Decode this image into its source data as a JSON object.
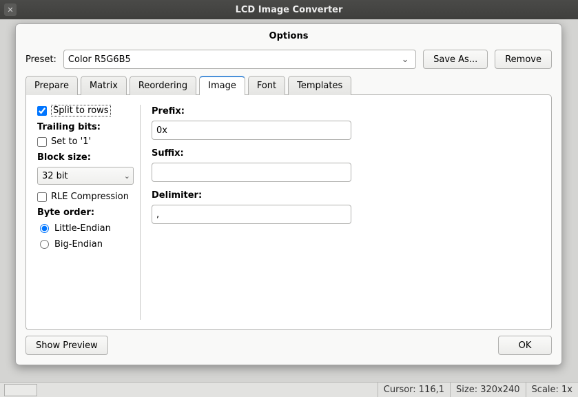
{
  "titlebar": {
    "title": "LCD Image Converter"
  },
  "dialog": {
    "title": "Options"
  },
  "preset": {
    "label": "Preset:",
    "selected": "Color R5G6B5",
    "save_as": "Save As...",
    "remove": "Remove"
  },
  "tabs": {
    "items": [
      "Prepare",
      "Matrix",
      "Reordering",
      "Image",
      "Font",
      "Templates"
    ],
    "active_index": 3
  },
  "image_tab": {
    "split_to_rows": {
      "label": "Split to rows",
      "checked": true
    },
    "trailing_bits_label": "Trailing bits:",
    "set_to_1": {
      "label": "Set to '1'",
      "checked": false
    },
    "block_size_label": "Block size:",
    "block_size_value": "32 bit",
    "rle": {
      "label": "RLE Compression",
      "checked": false
    },
    "byte_order_label": "Byte order:",
    "byte_order": {
      "little": "Little-Endian",
      "big": "Big-Endian",
      "selected": "little"
    },
    "prefix_label": "Prefix:",
    "prefix_value": "0x",
    "suffix_label": "Suffix:",
    "suffix_value": "",
    "delimiter_label": "Delimiter:",
    "delimiter_value": ","
  },
  "footer": {
    "show_preview": "Show Preview",
    "ok": "OK"
  },
  "status": {
    "cursor": "Cursor: 116,1",
    "size": "Size: 320x240",
    "scale": "Scale: 1x"
  }
}
